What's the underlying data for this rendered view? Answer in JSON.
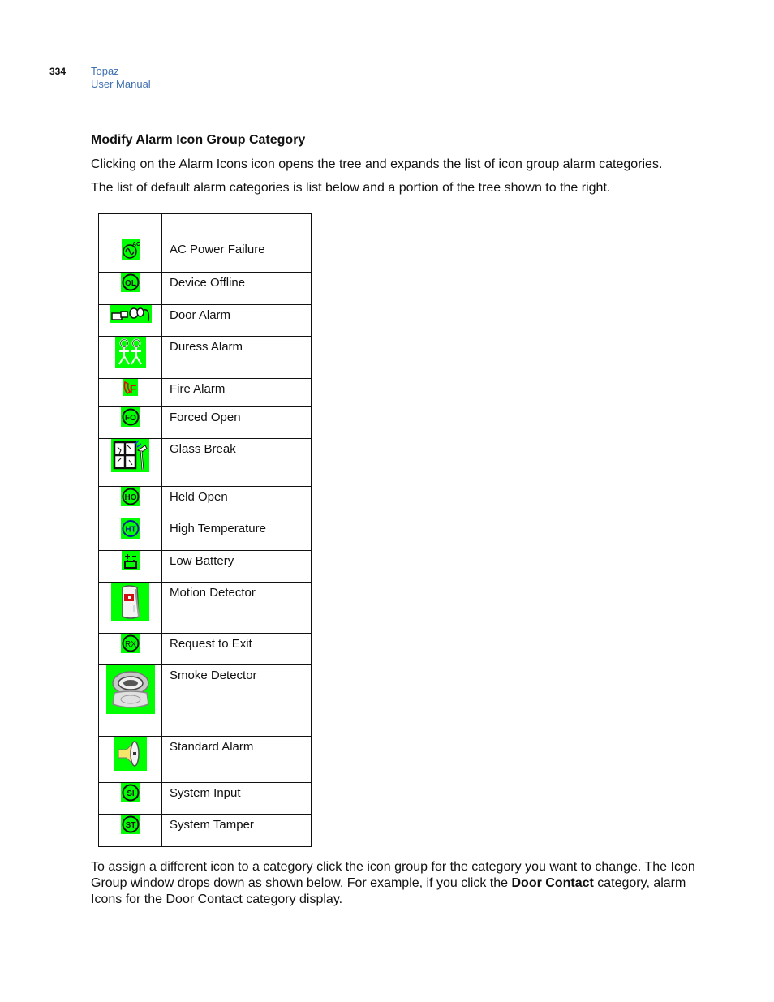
{
  "header": {
    "page_number": "334",
    "product": "Topaz",
    "manual": "User Manual"
  },
  "section": {
    "heading": "Modify Alarm Icon Group Category",
    "paragraph1": "Clicking on the Alarm Icons icon opens the tree and expands the list of icon group alarm categories.",
    "paragraph2": "The list of default alarm categories is list below and a portion of the tree shown to the right."
  },
  "table": {
    "header": [
      "",
      ""
    ],
    "rows": [
      {
        "icon": "ac-power-failure-icon",
        "label": "AC Power Failure"
      },
      {
        "icon": "device-offline-icon",
        "label": "Device Offline"
      },
      {
        "icon": "door-alarm-icon",
        "label": "Door Alarm"
      },
      {
        "icon": "duress-alarm-icon",
        "label": "Duress Alarm"
      },
      {
        "icon": "fire-alarm-icon",
        "label": "Fire Alarm"
      },
      {
        "icon": "forced-open-icon",
        "label": "Forced Open"
      },
      {
        "icon": "glass-break-icon",
        "label": "Glass Break"
      },
      {
        "icon": "held-open-icon",
        "label": "Held Open"
      },
      {
        "icon": "high-temperature-icon",
        "label": "High Temperature"
      },
      {
        "icon": "low-battery-icon",
        "label": "Low Battery"
      },
      {
        "icon": "motion-detector-icon",
        "label": "Motion Detector"
      },
      {
        "icon": "request-to-exit-icon",
        "label": "Request to Exit"
      },
      {
        "icon": "smoke-detector-icon",
        "label": "Smoke Detector"
      },
      {
        "icon": "standard-alarm-icon",
        "label": "Standard Alarm"
      },
      {
        "icon": "system-input-icon",
        "label": "System Input"
      },
      {
        "icon": "system-tamper-icon",
        "label": "System Tamper"
      }
    ],
    "icon_text": {
      "ac": "AC",
      "ol": "OL",
      "fo": "FO",
      "ho": "HO",
      "ht": "HT",
      "rx": "RX",
      "si": "SI",
      "st": "ST",
      "fire": "F"
    }
  },
  "footer_paragraph": {
    "text_before": "To assign a different icon to a category click the icon group for the category you want to change. The Icon Group window drops down as shown below. For example, if you click the ",
    "bold": "Door Contact",
    "text_after": " category, alarm Icons for the Door Contact category display."
  },
  "colors": {
    "icon_background": "#00ff00",
    "header_accent": "#3e6fb0"
  }
}
